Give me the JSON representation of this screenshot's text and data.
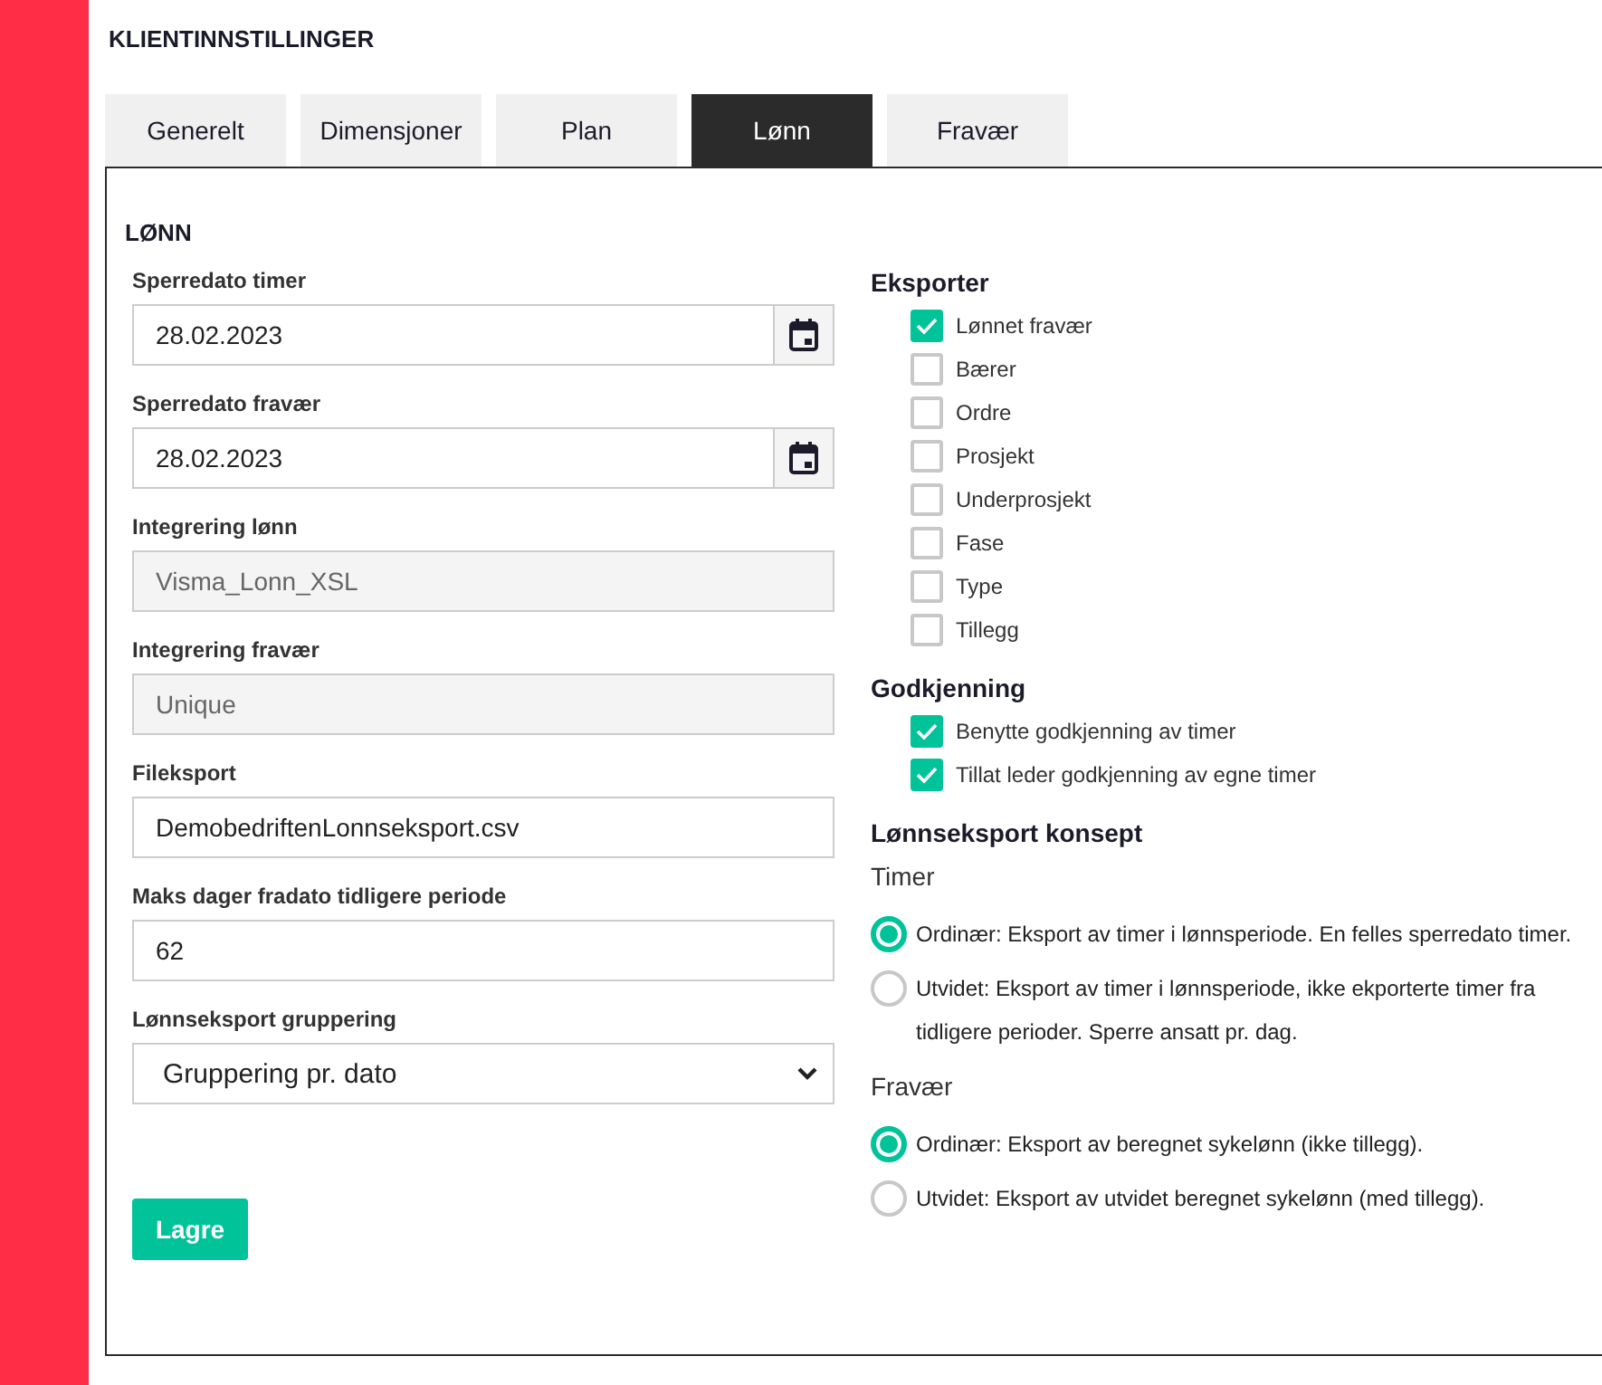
{
  "page_title": "KLIENTINNSTILLINGER",
  "tabs": [
    {
      "label": "Generelt",
      "selected": false
    },
    {
      "label": "Dimensjoner",
      "selected": false
    },
    {
      "label": "Plan",
      "selected": false
    },
    {
      "label": "Lønn",
      "selected": true
    },
    {
      "label": "Fravær",
      "selected": false
    }
  ],
  "section_title": "LØNN",
  "fields": [
    {
      "label": "Sperredato timer",
      "kind": "date",
      "value": "28.02.2023"
    },
    {
      "label": "Sperredato fravær",
      "kind": "date",
      "value": "28.02.2023"
    },
    {
      "label": "Integrering lønn",
      "kind": "disabled",
      "value": "Visma_Lonn_XSL"
    },
    {
      "label": "Integrering fravær",
      "kind": "disabled",
      "value": "Unique"
    },
    {
      "label": "Fileksport",
      "kind": "text",
      "value": "DemobedriftenLonnseksport.csv"
    },
    {
      "label": "Maks dager fradato tidligere periode",
      "kind": "text",
      "value": "62"
    },
    {
      "label": "Lønnseksport gruppering",
      "kind": "select",
      "value": "Gruppering pr. dato"
    }
  ],
  "save_button": "Lagre",
  "checkbox_groups": [
    {
      "title": "Eksporter",
      "items": [
        {
          "label": "Lønnet fravær",
          "checked": true
        },
        {
          "label": "Bærer",
          "checked": false
        },
        {
          "label": "Ordre",
          "checked": false
        },
        {
          "label": "Prosjekt",
          "checked": false
        },
        {
          "label": "Underprosjekt",
          "checked": false
        },
        {
          "label": "Fase",
          "checked": false
        },
        {
          "label": "Type",
          "checked": false
        },
        {
          "label": "Tillegg",
          "checked": false
        }
      ]
    },
    {
      "title": "Godkjenning",
      "items": [
        {
          "label": "Benytte godkjenning av timer",
          "checked": true
        },
        {
          "label": "Tillat leder godkjenning av egne timer",
          "checked": true
        }
      ]
    }
  ],
  "export_concept": {
    "title": "Lønnseksport konsept",
    "groups": [
      {
        "label": "Timer",
        "options": [
          {
            "text": "Ordinær: Eksport av timer i lønnsperiode. En felles sperredato timer.",
            "selected": true
          },
          {
            "text": "Utvidet: Eksport av timer i lønnsperiode, ikke ekporterte timer fra tidligere perioder. Sperre ansatt pr. dag.",
            "selected": false
          }
        ]
      },
      {
        "label": "Fravær",
        "options": [
          {
            "text": "Ordinær: Eksport av beregnet sykelønn (ikke tillegg).",
            "selected": true
          },
          {
            "text": "Utvidet: Eksport av utvidet beregnet sykelønn (med tillegg).",
            "selected": false
          }
        ]
      }
    ]
  }
}
